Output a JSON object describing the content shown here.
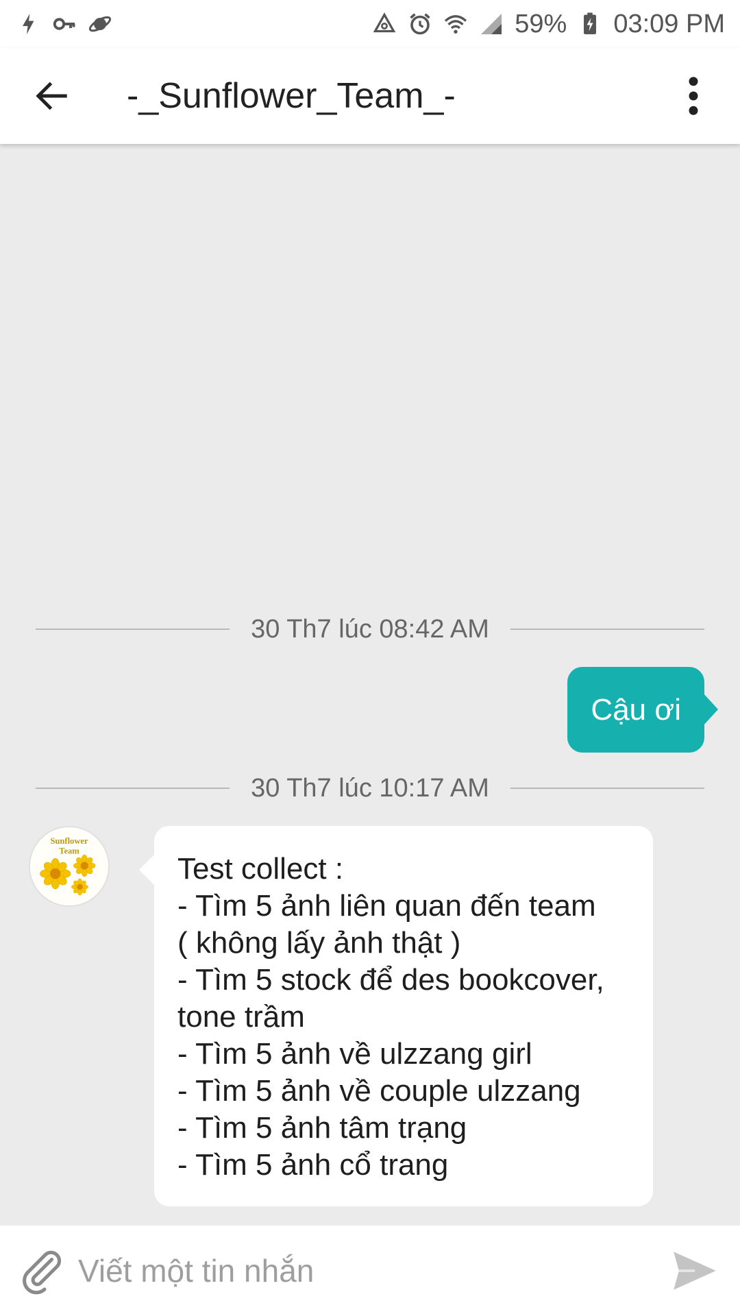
{
  "status_bar": {
    "left_icons": [
      "flash-icon",
      "key-icon",
      "planet-icon"
    ],
    "right_icons": [
      "data-saver-icon",
      "alarm-icon",
      "wifi-icon",
      "signal-icon",
      "battery-charging-icon"
    ],
    "battery": "59%",
    "time": "03:09 PM"
  },
  "app_bar": {
    "title": "-_Sunflower_Team_-",
    "back_icon": "arrow-back-icon",
    "menu_icon": "more-vert-icon"
  },
  "conversation": {
    "separators": [
      {
        "label": "30 Th7 lúc 08:42 AM"
      },
      {
        "label": "30 Th7 lúc 10:17 AM"
      }
    ],
    "outgoing": {
      "text": "Cậu ơi"
    },
    "incoming": {
      "avatar_text": [
        "Sunflower",
        "Team"
      ],
      "lines": [
        "Test collect :",
        "- Tìm 5 ảnh liên quan đến team",
        "( không lấy ảnh thật )",
        "- Tìm 5 stock để des bookcover,",
        "tone trầm",
        "- Tìm 5 ảnh về ulzzang girl",
        "- Tìm 5 ảnh về couple ulzzang",
        "- Tìm 5 ảnh tâm trạng",
        "- Tìm 5 ảnh cổ trang"
      ]
    }
  },
  "composer": {
    "placeholder": "Viết một tin nhắn",
    "value": "",
    "attach_icon": "paperclip-icon",
    "send_icon": "send-icon"
  },
  "colors": {
    "accent": "#16b1ae",
    "background": "#ebebeb",
    "bubble_in": "#ffffff"
  }
}
